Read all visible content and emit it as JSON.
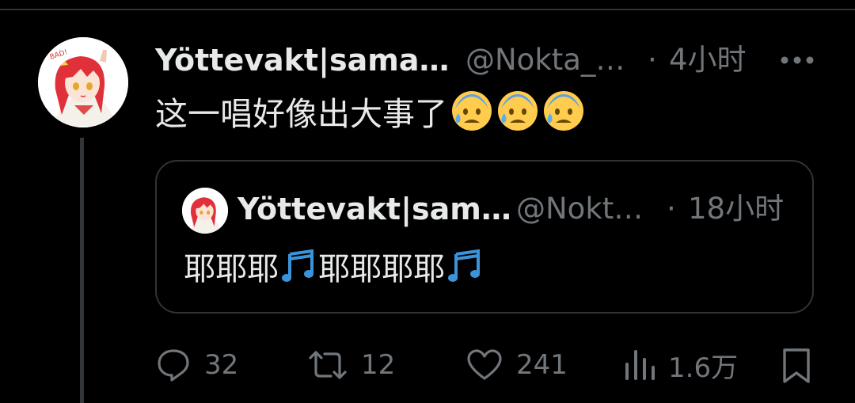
{
  "tweet": {
    "author_name": "Yöttevakt|sama…",
    "handle": "@Nokta_…",
    "separator": "·",
    "time": "4小时",
    "text": "这一唱好像出大事了",
    "emojis": [
      "anxious-face-with-sweat",
      "anxious-face-with-sweat",
      "anxious-face-with-sweat"
    ],
    "avatar_badge": "BAD!"
  },
  "quote": {
    "author_name": "Yöttevakt|sam…",
    "handle": "@Nokt…",
    "separator": "·",
    "time": "18小时",
    "text_part1": "耶耶耶",
    "text_part2": "耶耶耶耶",
    "emoji": "multiple-musical-notes"
  },
  "actions": {
    "replies": "32",
    "retweets": "12",
    "likes": "241",
    "views": "1.6万"
  },
  "colors": {
    "background": "#000000",
    "text": "#e7e9ea",
    "muted": "#71767b",
    "border": "#2f3336",
    "note_blue": "#3b94d9",
    "emoji_yellow": "#ffcc4d"
  }
}
